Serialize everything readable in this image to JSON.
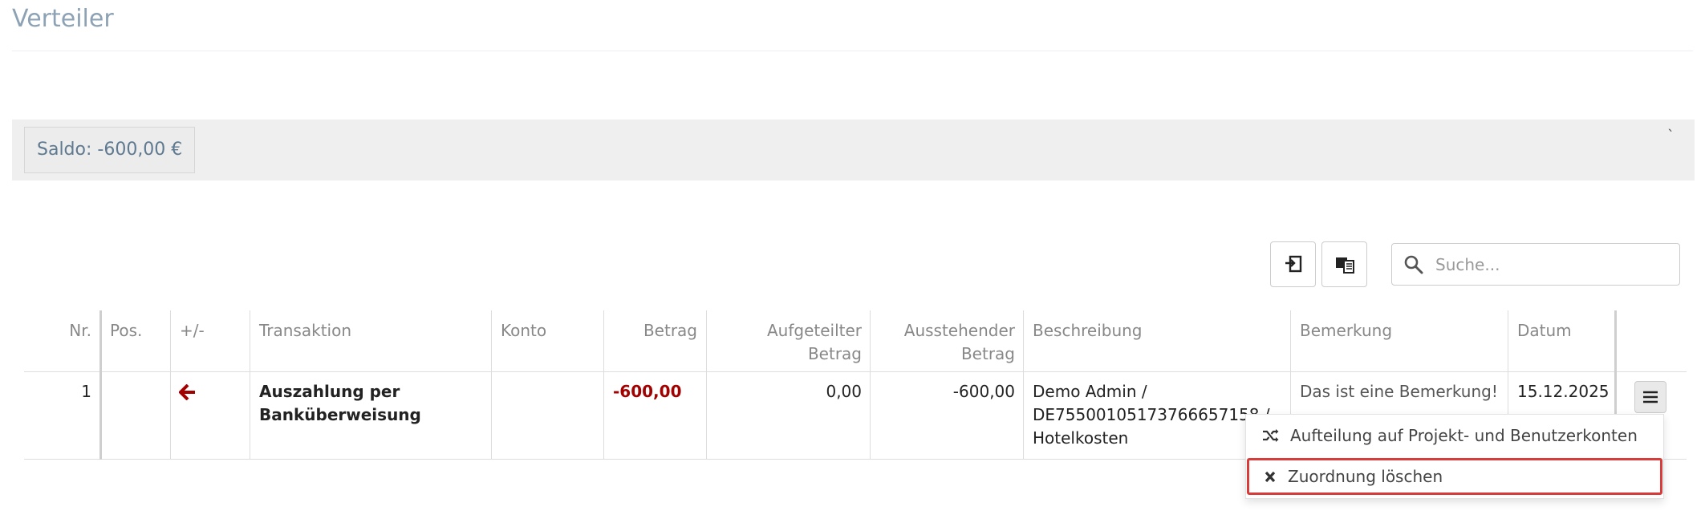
{
  "page": {
    "title": "Verteiler"
  },
  "saldo": {
    "label": "Saldo: -600,00 €",
    "collapse_mark": "`"
  },
  "toolbar": {
    "search_placeholder": "Suche..."
  },
  "table": {
    "headers": {
      "nr": "Nr.",
      "pos": "Pos.",
      "sign": "+/-",
      "transaction": "Transaktion",
      "account": "Konto",
      "amount": "Betrag",
      "split_amount_1": "Aufgeteilter",
      "split_amount_2": "Betrag",
      "outstanding_1": "Ausstehender",
      "outstanding_2": "Betrag",
      "description": "Beschreibung",
      "remark": "Bemerkung",
      "date": "Datum"
    },
    "rows": [
      {
        "nr": "1",
        "pos": "",
        "transaction_1": "Auszahlung per",
        "transaction_2": "Banküberweisung",
        "account": "",
        "amount": "-600,00",
        "split_amount": "0,00",
        "outstanding": "-600,00",
        "description_1": "Demo Admin /",
        "description_2": "DE75500105173766657158 /",
        "description_3": "Hotelkosten",
        "remark": "Das ist eine Bemerkung!",
        "date": "15.12.2025"
      }
    ]
  },
  "dropdown": {
    "items": [
      {
        "label": "Aufteilung auf Projekt- und Benutzerkonten",
        "icon": "shuffle-icon"
      },
      {
        "label": "Zuordnung löschen",
        "icon": "close-icon"
      }
    ]
  },
  "colors": {
    "title": "#8da2b5",
    "negative": "#a30000",
    "highlight_border": "#d93a3a",
    "saldo_bar": "#efefef"
  }
}
